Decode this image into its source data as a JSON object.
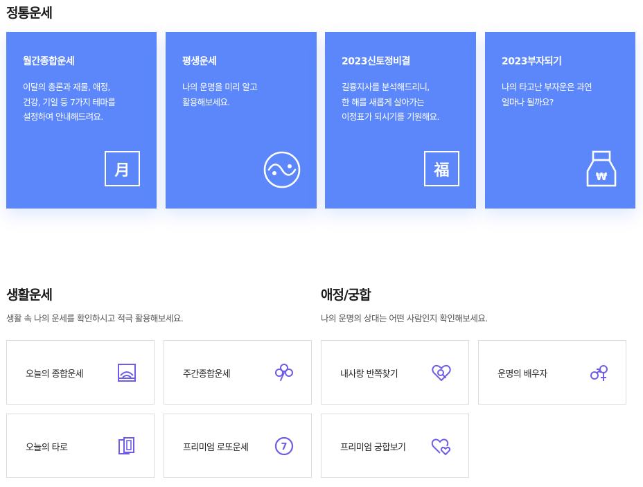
{
  "fortune_section": {
    "title": "정통운세",
    "cards": [
      {
        "title": "월간종합운세",
        "desc": [
          "이달의 총론과 재물, 애정,",
          "건강, 기일 등 7가지 테마를",
          "설정하여 안내해드려요."
        ],
        "icon": "moon-month-icon",
        "icon_char": "月"
      },
      {
        "title": "평생운세",
        "desc": [
          "나의 운명을 미리 알고",
          "활용해보세요."
        ],
        "icon": "yin-yang-icon"
      },
      {
        "title": "2023신토정비결",
        "desc": [
          "길흉지사를 분석해드리니,",
          "한 해를 새롭게 살아가는",
          "이정표가 되시기를 기원해요."
        ],
        "icon": "fortune-blessing-icon",
        "icon_char": "福"
      },
      {
        "title": "2023부자되기",
        "desc": [
          "나의 타고난 부자운은 과연",
          "얼마나 될까요?"
        ],
        "icon": "money-bag-icon",
        "icon_char": "₩"
      }
    ]
  },
  "life_section": {
    "title": "생활운세",
    "subtitle": "생활 속 나의 운세를 확인하시고 적극 활용해보세요.",
    "tiles": [
      {
        "label": "오늘의 종합운세",
        "icon": "sunrise-icon"
      },
      {
        "label": "주간종합운세",
        "icon": "clover-icon"
      },
      {
        "label": "오늘의 타로",
        "icon": "tarot-cards-icon"
      },
      {
        "label": "프리미엄 로또운세",
        "icon": "lotto-ball-icon",
        "icon_char": "7"
      }
    ]
  },
  "love_section": {
    "title": "애정/궁합",
    "subtitle": "나의 운명의 상대는 어떤 사람인지 확인해보세요.",
    "tiles": [
      {
        "label": "내사랑 반쪽찾기",
        "icon": "heart-search-icon"
      },
      {
        "label": "운명의 배우자",
        "icon": "gender-symbols-icon"
      },
      {
        "label": "프리미엄 궁합보기",
        "icon": "double-heart-icon"
      }
    ]
  },
  "colors": {
    "card_blue": "#5b87fb",
    "icon_purple": "#6c5ce7"
  }
}
